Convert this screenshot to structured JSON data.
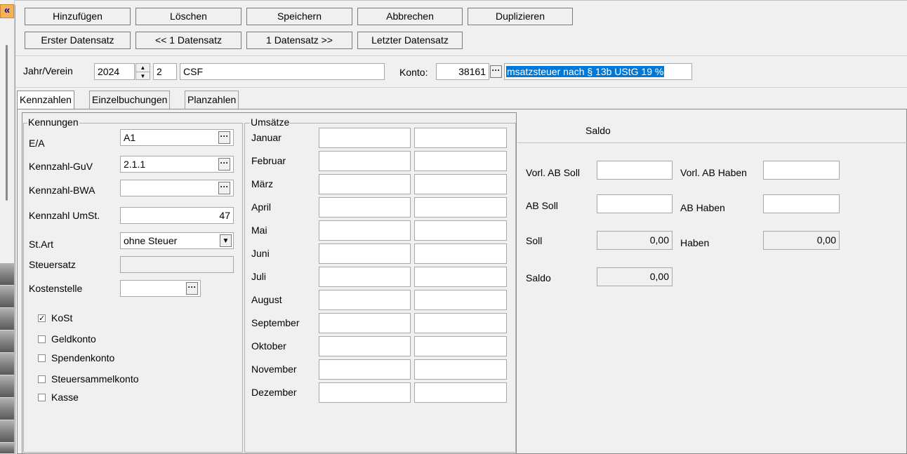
{
  "toolbar": {
    "row1": [
      "Hinzufügen",
      "Löschen",
      "Speichern",
      "Abbrechen",
      "Duplizieren"
    ],
    "row2": [
      "Erster Datensatz",
      "<< 1 Datensatz",
      "1 Datensatz >>",
      "Letzter Datensatz"
    ]
  },
  "rail": {
    "collapse_label": "«"
  },
  "header": {
    "jahr_label": "Jahr/Verein",
    "jahr_value": "2024",
    "verein_value": "2",
    "verein_name": "CSF",
    "konto_label": "Konto:",
    "konto_value": "38161",
    "konto_desc": "msatzsteuer nach § 13b UStG 19 %"
  },
  "tabs": [
    "Kennzahlen",
    "Einzelbuchungen",
    "Planzahlen"
  ],
  "kennungen": {
    "legend": "Kennungen",
    "ea_label": "E/A",
    "ea_value": "A1",
    "guv_label": "Kennzahl-GuV",
    "guv_value": "2.1.1",
    "bwa_label": "Kennzahl-BWA",
    "bwa_value": "",
    "umst_label": "Kennzahl UmSt.",
    "umst_value": "47",
    "stapart_label": "St.Art",
    "stapart_value": "ohne Steuer",
    "steuersatz_label": "Steuersatz",
    "steuersatz_value": "",
    "kostenstelle_label": "Kostenstelle",
    "kostenstelle_value": "",
    "checkboxes": [
      {
        "label": "KoSt",
        "checked": "✓"
      },
      {
        "label": "Geldkonto",
        "checked": ""
      },
      {
        "label": "Spendenkonto",
        "checked": ""
      },
      {
        "label": "Steuersammelkonto",
        "checked": ""
      },
      {
        "label": "Kasse",
        "checked": ""
      }
    ]
  },
  "umsaetze": {
    "legend": "Umsätze",
    "months": [
      "Januar",
      "Februar",
      "März",
      "April",
      "Mai",
      "Juni",
      "Juli",
      "August",
      "September",
      "Oktober",
      "November",
      "Dezember"
    ]
  },
  "saldo": {
    "title": "Saldo",
    "vorl_ab_soll_label": "Vorl. AB Soll",
    "vorl_ab_soll_value": "",
    "vorl_ab_haben_label": "Vorl. AB Haben",
    "vorl_ab_haben_value": "",
    "ab_soll_label": "AB Soll",
    "ab_soll_value": "",
    "ab_haben_label": "AB Haben",
    "ab_haben_value": "",
    "soll_label": "Soll",
    "soll_value": "0,00",
    "haben_label": "Haben",
    "haben_value": "0,00",
    "saldo_label": "Saldo",
    "saldo_value": "0,00"
  },
  "colors": {
    "accent": "#f5b25a",
    "selection": "#0078d7"
  }
}
